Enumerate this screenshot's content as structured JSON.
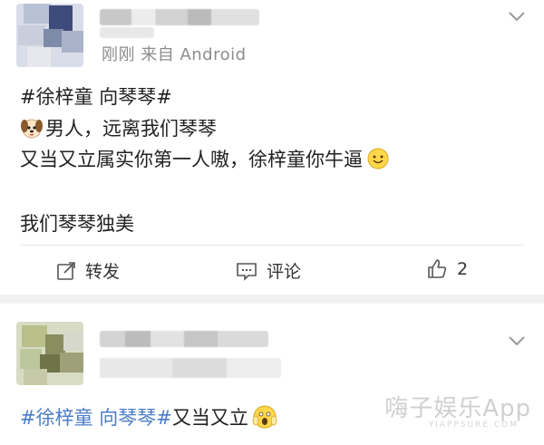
{
  "post1": {
    "meta": "刚刚  来自 Android",
    "hashtag": "#徐梓童 向琴琴#",
    "line1": "男人，远离我们琴琴",
    "line2": "又当又立属实你第一人嗷，徐梓童你牛逼",
    "line3": "我们琴琴独美",
    "actions": {
      "repost_label": "转发",
      "comment_label": "评论",
      "like_count": "2"
    }
  },
  "post2": {
    "hashtag": "#徐梓童 向琴琴#",
    "text": "又当又立"
  },
  "watermark": {
    "main": "嗨子娱乐App",
    "sub": "YIAPPSURE.COM"
  },
  "colors": {
    "hashtag": "#4c7cc5",
    "meta": "#8c8c8c",
    "separator": "#f2f2f2"
  },
  "icons": [
    "chevron-down-icon",
    "repost-icon",
    "comment-icon",
    "like-icon",
    "dog-emoji-icon",
    "smile-emoji-icon",
    "scream-emoji-icon"
  ]
}
